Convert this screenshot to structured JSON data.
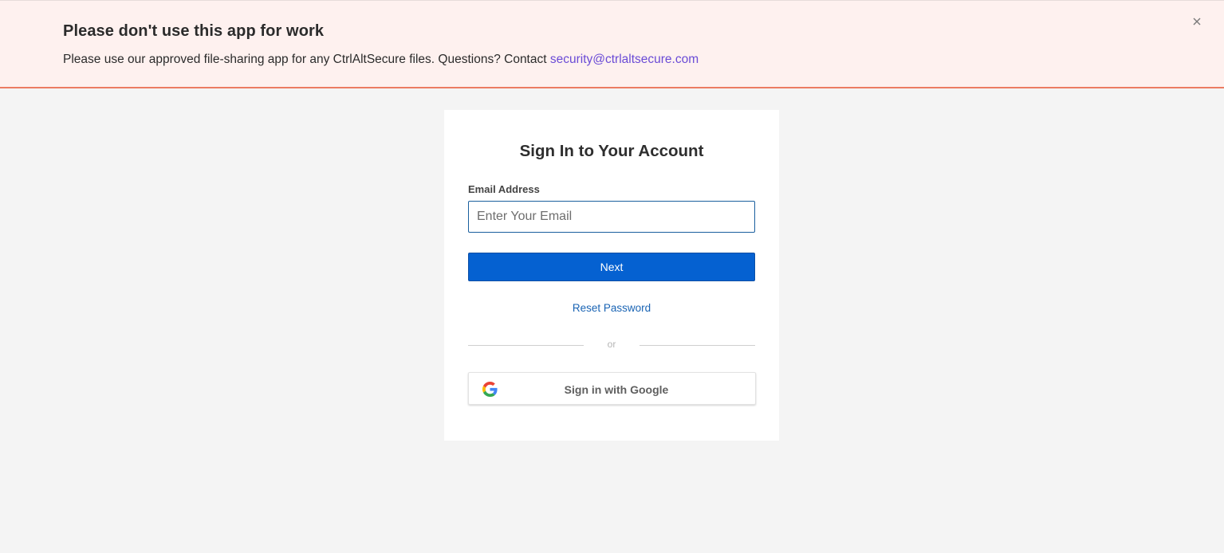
{
  "banner": {
    "title": "Please don't use this app for work",
    "message": "Please use our approved file-sharing app for any CtrlAltSecure files. Questions? Contact ",
    "contact_email": "security@ctrlaltsecure.com",
    "close_icon": "close-icon",
    "background_color": "#fef1ef",
    "border_color": "#ec7c62"
  },
  "signin": {
    "title": "Sign In to Your Account",
    "email_label": "Email Address",
    "email_value": "",
    "email_placeholder": "Enter Your Email",
    "next_label": "Next",
    "reset_label": "Reset Password",
    "divider_text": "or",
    "google_label": "Sign in with Google",
    "google_icon": "google-icon",
    "accent_color": "#0561d1"
  }
}
